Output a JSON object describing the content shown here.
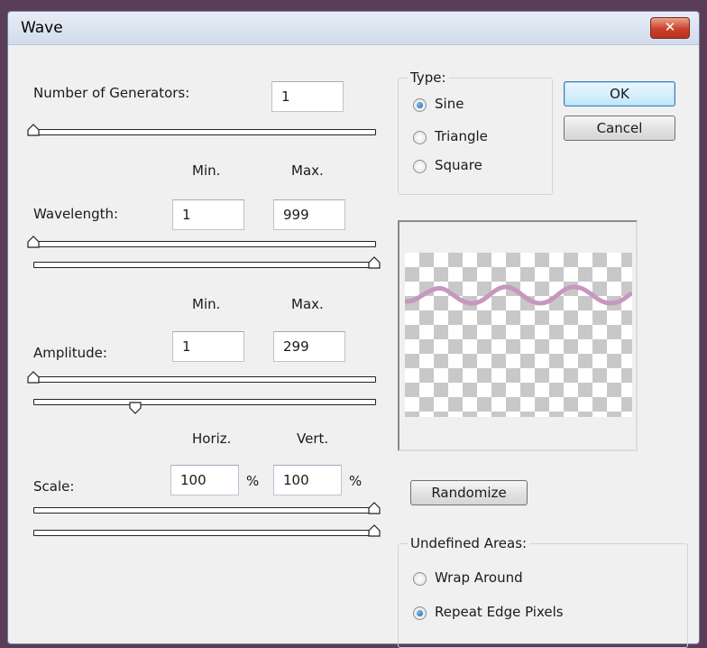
{
  "dialog": {
    "title": "Wave",
    "close_glyph": "✕"
  },
  "generators": {
    "label": "Number of Generators:",
    "value": "1",
    "slider_level": 0.0
  },
  "headers": {
    "min": "Min.",
    "max": "Max.",
    "horiz": "Horiz.",
    "vert": "Vert."
  },
  "wavelength": {
    "label": "Wavelength:",
    "min": "1",
    "max": "999",
    "min_level": 0.0,
    "max_level": 1.0
  },
  "amplitude": {
    "label": "Amplitude:",
    "min": "1",
    "max": "299",
    "min_level": 0.0,
    "max_level": 0.3
  },
  "scale": {
    "label": "Scale:",
    "horiz": "100",
    "vert": "100",
    "unit": "%",
    "horiz_level": 1.0,
    "vert_level": 1.0
  },
  "type": {
    "legend": "Type:",
    "options": [
      "Sine",
      "Triangle",
      "Square"
    ],
    "selected": "Sine"
  },
  "buttons": {
    "ok": "OK",
    "cancel": "Cancel",
    "randomize": "Randomize"
  },
  "undefined_areas": {
    "legend": "Undefined Areas:",
    "options": [
      "Wrap Around",
      "Repeat Edge Pixels"
    ],
    "selected": "Repeat Edge Pixels"
  },
  "colors": {
    "wave_stroke": "#c797bf",
    "titlebar": "#d1dcec"
  }
}
